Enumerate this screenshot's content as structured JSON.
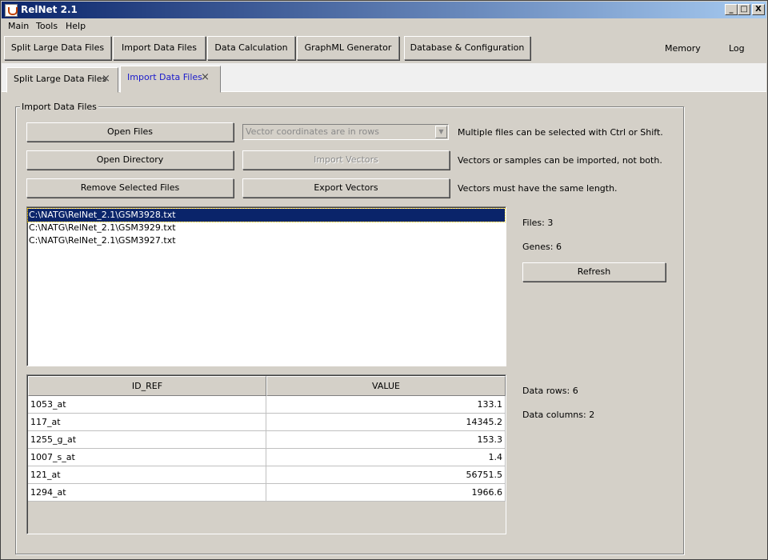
{
  "window": {
    "title": "RelNet 2.1",
    "controls": {
      "minimize": "_",
      "maximize": "□",
      "close": "X"
    }
  },
  "menu": [
    "Main",
    "Tools",
    "Help"
  ],
  "toolbar": {
    "buttons": [
      "Split Large Data Files",
      "Import Data Files",
      "Data Calculation",
      "GraphML Generator",
      "Database & Configuration"
    ],
    "memory": "Memory",
    "log": "Log"
  },
  "tabs": [
    {
      "label": "Split Large Data Files",
      "close": "×"
    },
    {
      "label": "Import Data Files",
      "close": "×"
    }
  ],
  "panel": {
    "group_title": "Import Data Files",
    "buttons": {
      "open_files": "Open Files",
      "open_directory": "Open Directory",
      "remove_selected": "Remove Selected Files",
      "import_vectors": "Import Vectors",
      "export_vectors": "Export Vectors"
    },
    "combo": {
      "value": "Vector coordinates are in rows",
      "arrow": "▼"
    },
    "hints": [
      "Multiple files can be selected with Ctrl or Shift.",
      "Vectors or samples can be imported, not both.",
      "Vectors must have the same length."
    ],
    "files": [
      "C:\\NATG\\RelNet_2.1\\GSM3928.txt",
      "C:\\NATG\\RelNet_2.1\\GSM3929.txt",
      "C:\\NATG\\RelNet_2.1\\GSM3927.txt"
    ],
    "files_count": "Files: 3",
    "genes_count": "Genes: 6",
    "refresh": "Refresh",
    "table": {
      "columns": [
        "ID_REF",
        "VALUE"
      ],
      "rows": [
        [
          "1053_at",
          "133.1"
        ],
        [
          "117_at",
          "14345.2"
        ],
        [
          "1255_g_at",
          "153.3"
        ],
        [
          "1007_s_at",
          "1.4"
        ],
        [
          "121_at",
          "56751.5"
        ],
        [
          "1294_at",
          "1966.6"
        ]
      ]
    },
    "data_rows": "Data rows: 6",
    "data_columns": "Data columns: 2"
  }
}
